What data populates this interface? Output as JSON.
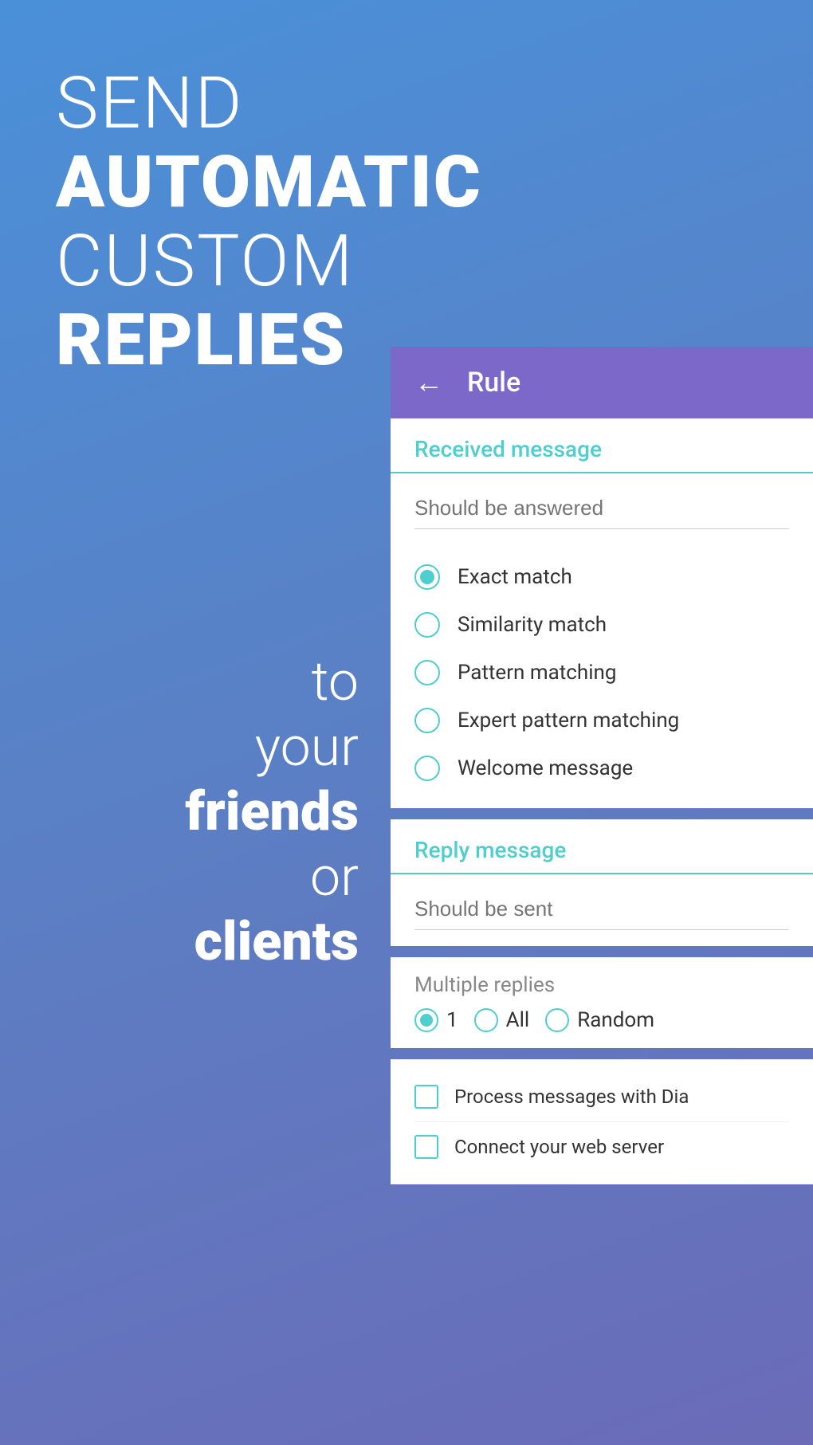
{
  "hero": {
    "send": "SEND",
    "automatic": "AUTOMATIC",
    "custom": "CUSTOM",
    "replies": "REPLIES"
  },
  "bottom_text": {
    "to": "to",
    "your": "your",
    "friends": "friends",
    "or": "or",
    "clients": "clients"
  },
  "topbar": {
    "title": "Rule",
    "back_icon": "←"
  },
  "received_message": {
    "header": "Received message",
    "placeholder": "Should be answered"
  },
  "match_options": [
    {
      "label": "Exact match",
      "selected": true
    },
    {
      "label": "Similarity match",
      "selected": false
    },
    {
      "label": "Pattern matching",
      "selected": false
    },
    {
      "label": "Expert pattern matching",
      "selected": false
    },
    {
      "label": "Welcome message",
      "selected": false
    }
  ],
  "reply_message": {
    "header": "Reply message",
    "placeholder": "Should be sent"
  },
  "multiple_replies": {
    "label": "Multiple replies",
    "options": [
      {
        "label": "1",
        "selected": true
      },
      {
        "label": "All",
        "selected": false
      },
      {
        "label": "Random",
        "selected": false
      }
    ]
  },
  "process_items": [
    {
      "label": "Process messages with Dia"
    },
    {
      "label": "Connect your web server"
    }
  ]
}
